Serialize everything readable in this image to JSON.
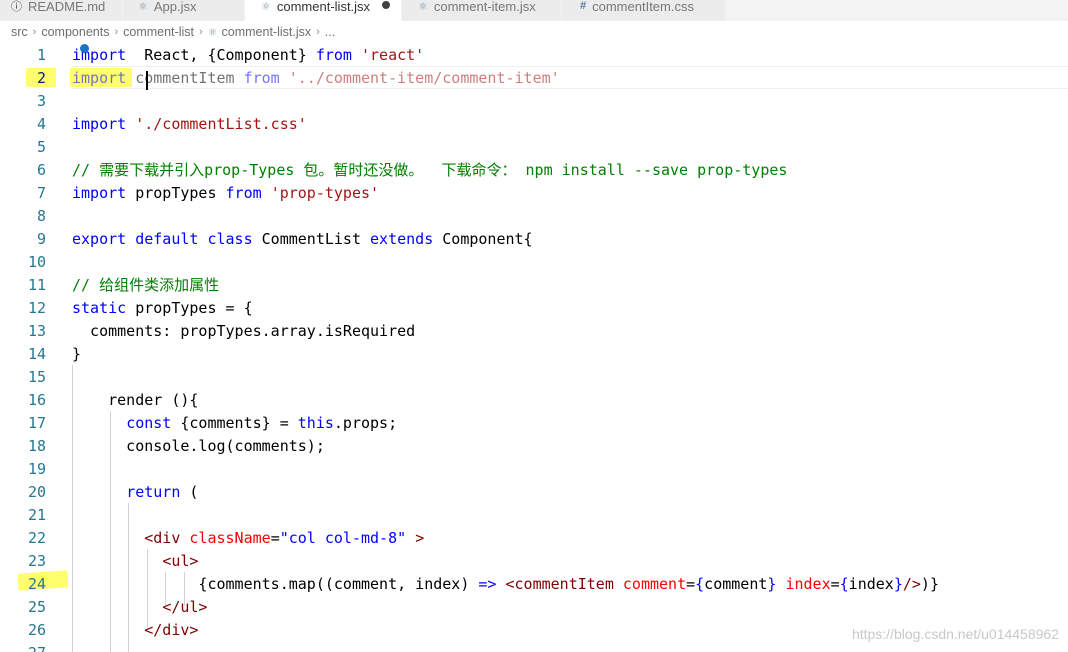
{
  "tabs": [
    {
      "icon": "info-icon",
      "label": "README.md",
      "active": false
    },
    {
      "icon": "react-icon",
      "label": "App.jsx",
      "active": false
    },
    {
      "icon": "react-icon",
      "label": "comment-list.jsx",
      "active": true,
      "dirty": true
    },
    {
      "icon": "react-icon",
      "label": "comment-item.jsx",
      "active": false
    },
    {
      "icon": "hash-icon",
      "label": "commentItem.css",
      "active": false
    }
  ],
  "breadcrumb": {
    "parts": [
      "src",
      "components",
      "comment-list",
      "comment-list.jsx",
      "..."
    ]
  },
  "editor": {
    "current_line": 2,
    "line_numbers": [
      "1",
      "2",
      "3",
      "4",
      "5",
      "6",
      "7",
      "8",
      "9",
      "10",
      "11",
      "12",
      "13",
      "14",
      "15",
      "16",
      "17",
      "18",
      "19",
      "20",
      "21",
      "22",
      "23",
      "24",
      "25",
      "26",
      "27"
    ],
    "lines": [
      [
        [
          "kw",
          "import"
        ],
        [
          "",
          "  React, {Component} "
        ],
        [
          "kw",
          "from"
        ],
        [
          "",
          " "
        ],
        [
          "str",
          "'react'"
        ]
      ],
      [
        [
          "kw dim",
          "import"
        ],
        [
          "dim",
          " commentItem "
        ],
        [
          "kw dim",
          "from"
        ],
        [
          "dim",
          " "
        ],
        [
          "str dim",
          "'../comment-item/comment-item'"
        ]
      ],
      [],
      [
        [
          "kw",
          "import"
        ],
        [
          "",
          " "
        ],
        [
          "str",
          "'./commentList.css'"
        ]
      ],
      [],
      [
        [
          "cmt",
          "// 需要下载并引入prop-Types 包。暂时还没做。  下载命令： npm install --save prop-types"
        ]
      ],
      [
        [
          "kw",
          "import"
        ],
        [
          "",
          " propTypes "
        ],
        [
          "kw",
          "from"
        ],
        [
          "",
          " "
        ],
        [
          "str",
          "'prop-types'"
        ]
      ],
      [],
      [
        [
          "kw",
          "export"
        ],
        [
          "",
          " "
        ],
        [
          "kw",
          "default"
        ],
        [
          "",
          " "
        ],
        [
          "kw",
          "class"
        ],
        [
          "",
          " CommentList "
        ],
        [
          "kw",
          "extends"
        ],
        [
          "",
          " Component{"
        ]
      ],
      [],
      [
        [
          "cmt",
          "// 给组件类添加属性"
        ]
      ],
      [
        [
          "kw",
          "static"
        ],
        [
          "",
          " propTypes = {"
        ]
      ],
      [
        [
          "",
          "  comments: propTypes.array.isRequired"
        ]
      ],
      [
        [
          "",
          "}"
        ]
      ],
      [],
      [
        [
          "",
          "    render (){"
        ]
      ],
      [
        [
          "",
          "      "
        ],
        [
          "kw",
          "const"
        ],
        [
          "",
          " {comments} = "
        ],
        [
          "kw",
          "this"
        ],
        [
          "",
          ".props;"
        ]
      ],
      [
        [
          "",
          "      console.log(comments);"
        ]
      ],
      [],
      [
        [
          "",
          "      "
        ],
        [
          "kw",
          "return"
        ],
        [
          "",
          " ("
        ]
      ],
      [],
      [
        [
          "",
          "        "
        ],
        [
          "tag",
          "<div"
        ],
        [
          "",
          " "
        ],
        [
          "attr",
          "className"
        ],
        [
          "",
          "="
        ],
        [
          "attrval",
          "\"col col-md-8\""
        ],
        [
          "",
          " "
        ],
        [
          "tag",
          ">"
        ]
      ],
      [
        [
          "",
          "          "
        ],
        [
          "tag",
          "<ul>"
        ]
      ],
      [
        [
          "",
          "              {comments.map((comment, index) "
        ],
        [
          "kw",
          "=>"
        ],
        [
          "",
          " "
        ],
        [
          "tag",
          "<commentItem"
        ],
        [
          "",
          " "
        ],
        [
          "attr",
          "comment"
        ],
        [
          "",
          "="
        ],
        [
          "kw",
          "{"
        ],
        [
          "",
          "comment"
        ],
        [
          "kw",
          "}"
        ],
        [
          "",
          " "
        ],
        [
          "attr",
          "index"
        ],
        [
          "",
          "="
        ],
        [
          "kw",
          "{"
        ],
        [
          "",
          "index"
        ],
        [
          "kw",
          "}"
        ],
        [
          "tag",
          "/>"
        ],
        [
          "",
          ")}"
        ]
      ],
      [
        [
          "",
          "          "
        ],
        [
          "tag",
          "</ul>"
        ]
      ],
      [
        [
          "",
          "        "
        ],
        [
          "tag",
          "</div>"
        ]
      ],
      []
    ]
  },
  "watermark": "https://blog.csdn.net/u014458962",
  "colors": {
    "keyword": "#0000ff",
    "string": "#a31515",
    "comment": "#008000",
    "tag": "#800000",
    "attribute": "#ff0000",
    "line_number": "#237893",
    "highlight": "#ffff55"
  }
}
